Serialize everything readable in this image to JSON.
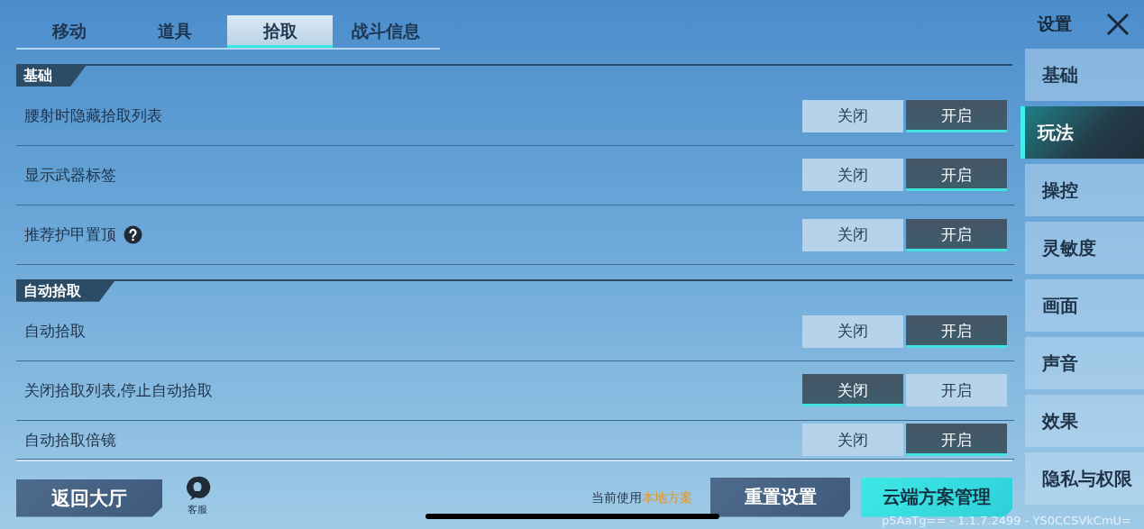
{
  "tabs": [
    {
      "label": "移动",
      "selected": false
    },
    {
      "label": "道具",
      "selected": false
    },
    {
      "label": "拾取",
      "selected": true
    },
    {
      "label": "战斗信息",
      "selected": false
    }
  ],
  "sections": [
    {
      "title": "基础",
      "rows": [
        {
          "label": "腰射时隐藏拾取列表",
          "help": false,
          "options": [
            {
              "label": "关闭",
              "selected": false
            },
            {
              "label": "开启",
              "selected": true
            }
          ]
        },
        {
          "label": "显示武器标签",
          "help": false,
          "options": [
            {
              "label": "关闭",
              "selected": false
            },
            {
              "label": "开启",
              "selected": true
            }
          ]
        },
        {
          "label": "推荐护甲置顶",
          "help": true,
          "options": [
            {
              "label": "关闭",
              "selected": false
            },
            {
              "label": "开启",
              "selected": true
            }
          ]
        }
      ]
    },
    {
      "title": "自动拾取",
      "rows": [
        {
          "label": "自动拾取",
          "help": false,
          "options": [
            {
              "label": "关闭",
              "selected": false
            },
            {
              "label": "开启",
              "selected": true
            }
          ]
        },
        {
          "label": "关闭拾取列表,停止自动拾取",
          "help": false,
          "options": [
            {
              "label": "关闭",
              "selected": true
            },
            {
              "label": "开启",
              "selected": false
            }
          ]
        },
        {
          "label": "自动拾取倍镜",
          "help": false,
          "options": [
            {
              "label": "关闭",
              "selected": false
            },
            {
              "label": "开启",
              "selected": true
            }
          ]
        }
      ]
    }
  ],
  "sidebar": {
    "title": "设置",
    "items": [
      {
        "label": "基础",
        "selected": false
      },
      {
        "label": "玩法",
        "selected": true
      },
      {
        "label": "操控",
        "selected": false
      },
      {
        "label": "灵敏度",
        "selected": false
      },
      {
        "label": "画面",
        "selected": false
      },
      {
        "label": "声音",
        "selected": false
      },
      {
        "label": "效果",
        "selected": false
      },
      {
        "label": "隐私与权限",
        "selected": false
      }
    ]
  },
  "footer": {
    "back_button": "返回大厅",
    "service_label": "客服",
    "status_prefix": "当前使用",
    "status_value": "本地方案",
    "buttons": [
      {
        "label": "重置设置",
        "kind": "secondary"
      },
      {
        "label": "云端方案管理",
        "kind": "primary"
      }
    ],
    "version": "p5AaTg== - 1.1.7.2499 - YS0CCSVkCmU="
  }
}
